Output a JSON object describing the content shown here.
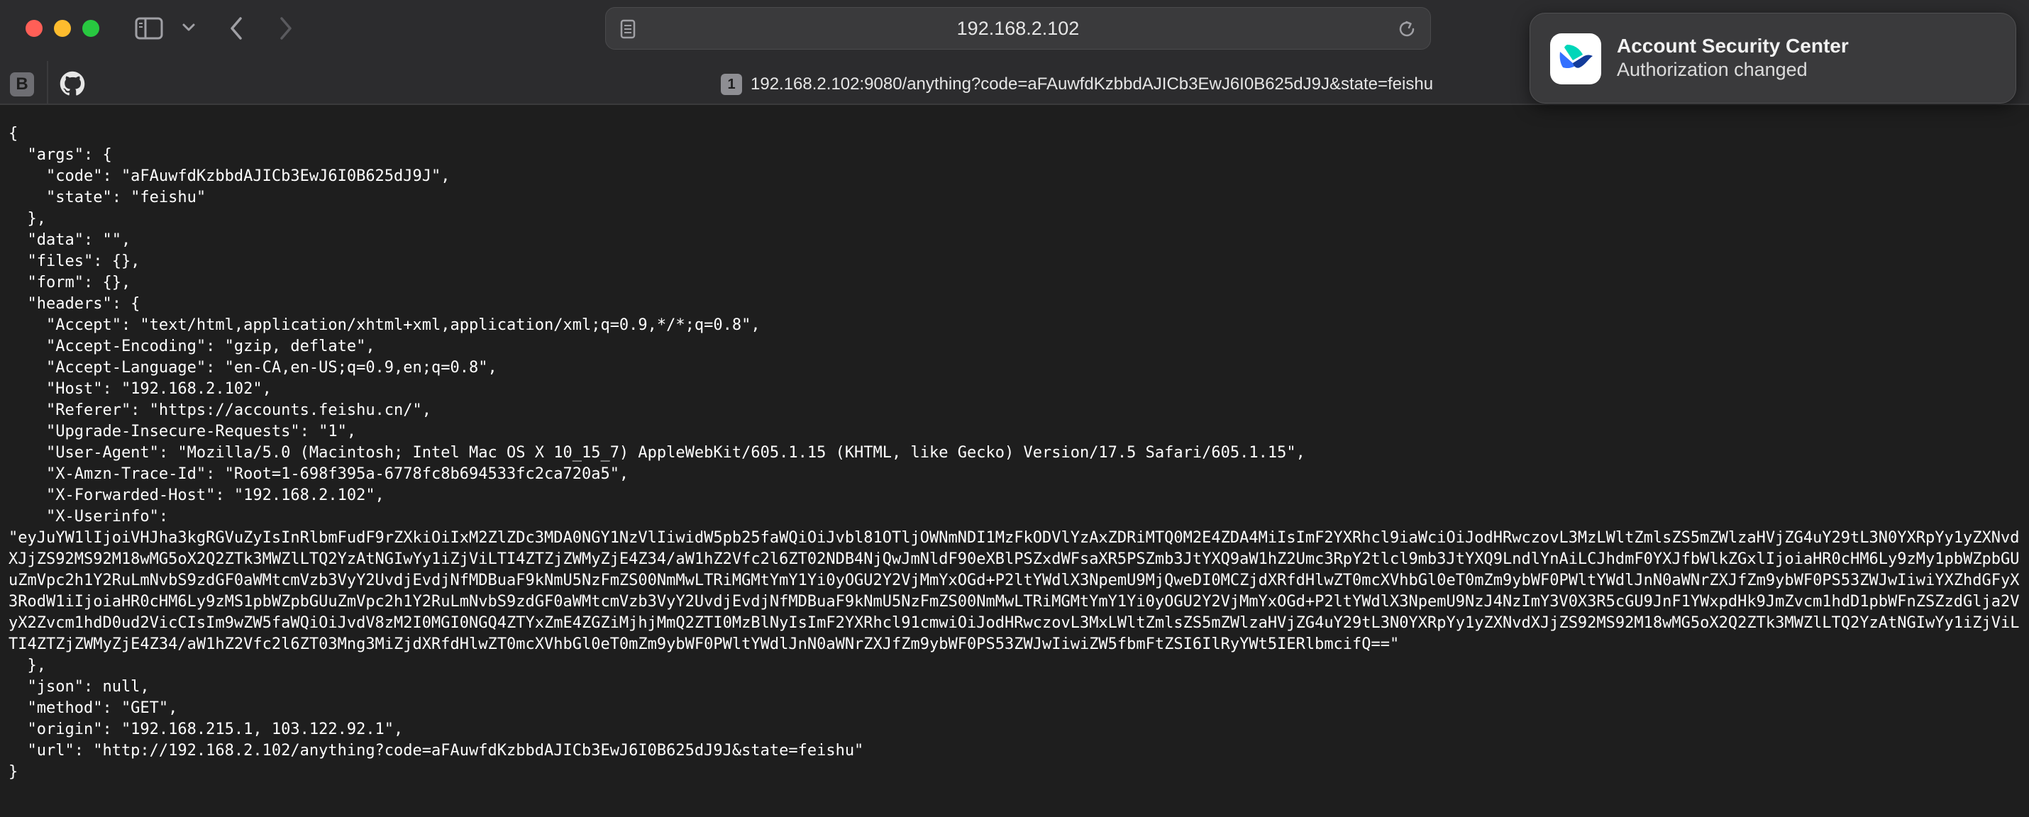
{
  "browser": {
    "address": "192.168.2.102",
    "tab_number": "1",
    "tab_title": "192.168.2.102:9080/anything?code=aFAuwfdKzbbdAJICb3EwJ6I0B625dJ9J&state=feishu",
    "favorites": [
      {
        "label": "B"
      }
    ]
  },
  "notification": {
    "title": "Account Security Center",
    "body": "Authorization changed"
  },
  "json_lines": [
    "{",
    "  \"args\": {",
    "    \"code\": \"aFAuwfdKzbbdAJICb3EwJ6I0B625dJ9J\",",
    "    \"state\": \"feishu\"",
    "  },",
    "  \"data\": \"\",",
    "  \"files\": {},",
    "  \"form\": {},",
    "  \"headers\": {",
    "    \"Accept\": \"text/html,application/xhtml+xml,application/xml;q=0.9,*/*;q=0.8\",",
    "    \"Accept-Encoding\": \"gzip, deflate\",",
    "    \"Accept-Language\": \"en-CA,en-US;q=0.9,en;q=0.8\",",
    "    \"Host\": \"192.168.2.102\",",
    "    \"Referer\": \"https://accounts.feishu.cn/\",",
    "    \"Upgrade-Insecure-Requests\": \"1\",",
    "    \"User-Agent\": \"Mozilla/5.0 (Macintosh; Intel Mac OS X 10_15_7) AppleWebKit/605.1.15 (KHTML, like Gecko) Version/17.5 Safari/605.1.15\",",
    "    \"X-Amzn-Trace-Id\": \"Root=1-698f395a-6778fc8b694533fc2ca720a5\",",
    "    \"X-Forwarded-Host\": \"192.168.2.102\",",
    "    \"X-Userinfo\":"
  ],
  "userinfo_value": "\"eyJuYW1lIjoiVHJha3kgRGVuZyIsInRlbmFudF9rZXkiOiIxM2ZlZDc3MDA0NGY1NzVlIiwidW5pb25faWQiOiJvbl81OTljOWNmNDI1MzFkODVlYzAxZDRiMTQ0M2E4ZDA4MiIsImF2YXRhcl9iaWciOiJodHRwczovL3MzLWltZmlsZS5mZWlzaHVjZG4uY29tL3N0YXRpYy1yZXNvdXJjZS92MS92M18wMG5oX2Q2ZTk3MWZlLTQ2YzAtNGIwYy1iZjViLTI4ZTZjZWMyZjE4Z34/aW1hZ2Vfc2l6ZT02NDB4NjQwJmNldF90eXBlPSZxdWFsaXR5PSZmb3JtYXQ9aW1hZ2Umc3RpY2tlcl9mb3JtYXQ9LndlYnAiLCJhdmF0YXJfbWlkZGxlIjoiaHR0cHM6Ly9zMy1pbWZpbGUuZmVpc2h1Y2RuLmNvbS9zdGF0aWMtcmVzb3VyY2UvdjEvdjNfMDBuaF9kNmU5NzFmZS00NmMwLTRiMGMtYmY1Yi0yOGU2Y2VjMmYxOGd+P2ltYWdlX3NpemU9MjQweDI0MCZjdXRfdHlwZT0mcXVhbGl0eT0mZm9ybWF0PWltYWdlJnN0aWNrZXJfZm9ybWF0PS53ZWJwIiwiYXZhdGFyX3RodW1iIjoiaHR0cHM6Ly9zMS1pbWZpbGUuZmVpc2h1Y2RuLmNvbS9zdGF0aWMtcmVzb3VyY2UvdjEvdjNfMDBuaF9kNmU5NzFmZS00NmMwLTRiMGMtYmY1Yi0yOGU2Y2VjMmYxOGd+P2ltYWdlX3NpemU9NzJ4NzImY3V0X3R5cGU9JnF1YWxpdHk9JmZvcm1hdD1pbWFnZSZzdGlja2VyX2Zvcm1hdD0ud2VicCIsIm9wZW5faWQiOiJvdV8zM2I0MGI0NGQ4ZTYxZmE4ZGZiMjhjMmQ2ZTI0MzBlNyIsImF2YXRhcl91cmwiOiJodHRwczovL3MxLWltZmlsZS5mZWlzaHVjZG4uY29tL3N0YXRpYy1yZXNvdXJjZS92MS92M18wMG5oX2Q2ZTk3MWZlLTQ2YzAtNGIwYy1iZjViLTI4ZTZjZWMyZjE4Z34/aW1hZ2Vfc2l6ZT03Mng3MiZjdXRfdHlwZT0mcXVhbGl0eT0mZm9ybWF0PWltYWdlJnN0aWNrZXJfZm9ybWF0PS53ZWJwIiwiZW5fbmFtZSI6IlRyYWt5IERlbmcifQ==\"",
  "json_tail_lines": [
    "  },",
    "  \"json\": null,",
    "  \"method\": \"GET\",",
    "  \"origin\": \"192.168.215.1, 103.122.92.1\",",
    "  \"url\": \"http://192.168.2.102/anything?code=aFAuwfdKzbbdAJICb3EwJ6I0B625dJ9J&state=feishu\"",
    "}"
  ],
  "colors": {
    "close": "#ff5f57",
    "minimize": "#febc2e",
    "zoom": "#28c840",
    "feishu_blue": "#3370ff",
    "feishu_teal": "#00d6b9"
  }
}
